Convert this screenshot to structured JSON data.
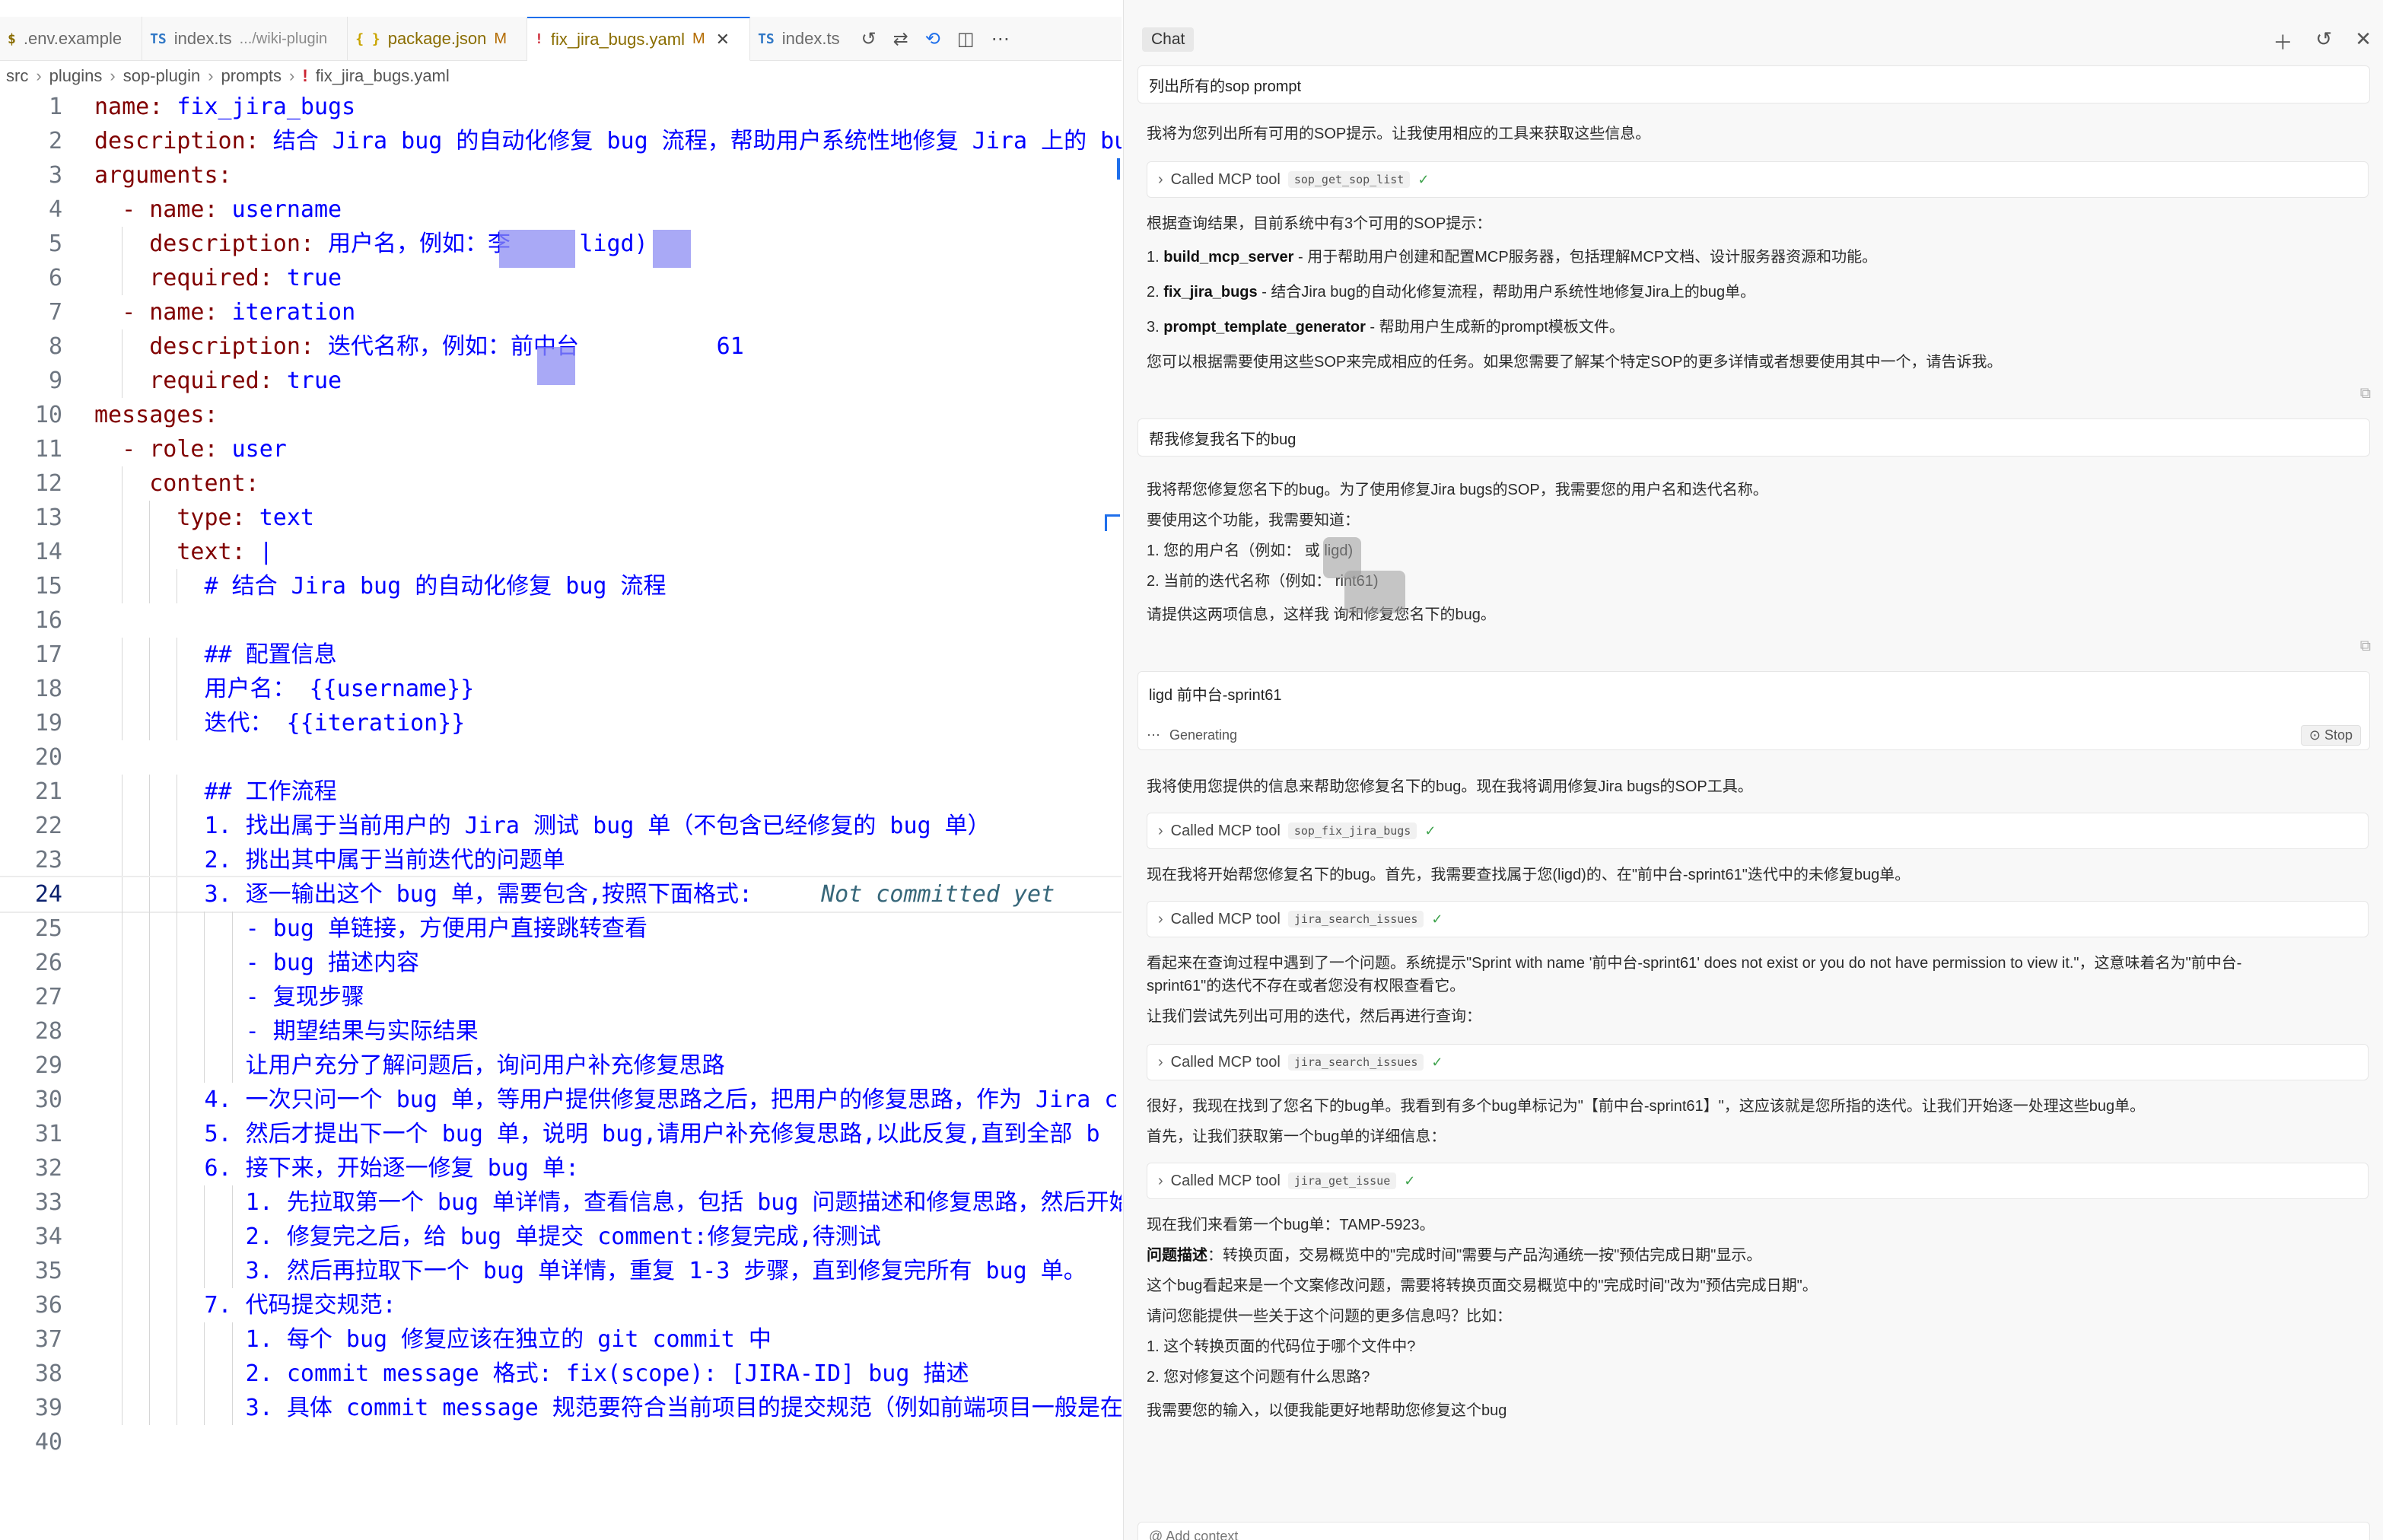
{
  "editor": {
    "tabs": [
      {
        "icon": "$",
        "name": ".env.example",
        "sub": "",
        "mod": "",
        "type": "env",
        "active": false
      },
      {
        "icon": "TS",
        "name": "index.ts",
        "sub": ".../wiki-plugin",
        "mod": "",
        "type": "ts",
        "active": false
      },
      {
        "icon": "{ }",
        "name": "package.json",
        "sub": "",
        "mod": "M",
        "type": "json",
        "active": false
      },
      {
        "icon": "!",
        "name": "fix_jira_bugs.yaml",
        "sub": "",
        "mod": "M",
        "type": "yaml",
        "active": true
      },
      {
        "icon": "TS",
        "name": "index.ts",
        "sub": "",
        "mod": "",
        "type": "ts",
        "active": false
      }
    ],
    "breadcrumb": [
      "src",
      "plugins",
      "sop-plugin",
      "prompts",
      "fix_jira_bugs.yaml"
    ],
    "ghost_text": "Not committed yet",
    "lines": [
      {
        "n": "1",
        "indent": 0,
        "key": "name:",
        "val": " fix_jira_bugs"
      },
      {
        "n": "2",
        "indent": 0,
        "key": "description:",
        "val": " 结合 Jira bug 的自动化修复 bug 流程，帮助用户系统性地修复 Jira 上的 bu"
      },
      {
        "n": "3",
        "indent": 0,
        "key": "arguments:",
        "val": ""
      },
      {
        "n": "4",
        "indent": 2,
        "key": "- name:",
        "val": " username"
      },
      {
        "n": "5",
        "indent": 4,
        "key": "description:",
        "val": " 用户名，例如：李     ligd)"
      },
      {
        "n": "6",
        "indent": 4,
        "key": "required:",
        "val": " true"
      },
      {
        "n": "7",
        "indent": 2,
        "key": "- name:",
        "val": " iteration"
      },
      {
        "n": "8",
        "indent": 4,
        "key": "description:",
        "val": " 迭代名称，例如：前中台          61"
      },
      {
        "n": "9",
        "indent": 4,
        "key": "required:",
        "val": " true"
      },
      {
        "n": "10",
        "indent": 0,
        "key": "messages:",
        "val": ""
      },
      {
        "n": "11",
        "indent": 2,
        "key": "- role:",
        "val": " user"
      },
      {
        "n": "12",
        "indent": 4,
        "key": "content:",
        "val": ""
      },
      {
        "n": "13",
        "indent": 6,
        "key": "type:",
        "val": " text"
      },
      {
        "n": "14",
        "indent": 6,
        "key": "text:",
        "val": " |"
      },
      {
        "n": "15",
        "indent": 8,
        "key": "",
        "val": "# 结合 Jira bug 的自动化修复 bug 流程"
      },
      {
        "n": "16",
        "indent": 0,
        "key": "",
        "val": ""
      },
      {
        "n": "17",
        "indent": 8,
        "key": "",
        "val": "## 配置信息"
      },
      {
        "n": "18",
        "indent": 8,
        "key": "",
        "val": "用户名： {{username}}"
      },
      {
        "n": "19",
        "indent": 8,
        "key": "",
        "val": "迭代： {{iteration}}"
      },
      {
        "n": "20",
        "indent": 0,
        "key": "",
        "val": ""
      },
      {
        "n": "21",
        "indent": 8,
        "key": "",
        "val": "## 工作流程"
      },
      {
        "n": "22",
        "indent": 8,
        "key": "",
        "val": "1. 找出属于当前用户的 Jira 测试 bug 单（不包含已经修复的 bug 单）"
      },
      {
        "n": "23",
        "indent": 8,
        "key": "",
        "val": "2. 挑出其中属于当前迭代的问题单"
      },
      {
        "n": "24",
        "indent": 8,
        "key": "",
        "val": "3. 逐一输出这个 bug 单，需要包含,按照下面格式:"
      },
      {
        "n": "25",
        "indent": 11,
        "key": "",
        "val": "- bug 单链接，方便用户直接跳转查看"
      },
      {
        "n": "26",
        "indent": 11,
        "key": "",
        "val": "- bug 描述内容"
      },
      {
        "n": "27",
        "indent": 11,
        "key": "",
        "val": "- 复现步骤"
      },
      {
        "n": "28",
        "indent": 11,
        "key": "",
        "val": "- 期望结果与实际结果"
      },
      {
        "n": "29",
        "indent": 11,
        "key": "",
        "val": "让用户充分了解问题后，询问用户补充修复思路"
      },
      {
        "n": "30",
        "indent": 8,
        "key": "",
        "val": "4. 一次只问一个 bug 单，等用户提供修复思路之后，把用户的修复思路，作为 Jira c"
      },
      {
        "n": "31",
        "indent": 8,
        "key": "",
        "val": "5. 然后才提出下一个 bug 单，说明 bug,请用户补充修复思路,以此反复,直到全部 b"
      },
      {
        "n": "32",
        "indent": 8,
        "key": "",
        "val": "6. 接下来，开始逐一修复 bug 单:"
      },
      {
        "n": "33",
        "indent": 11,
        "key": "",
        "val": "1. 先拉取第一个 bug 单详情，查看信息，包括 bug 问题描述和修复思路，然后开始"
      },
      {
        "n": "34",
        "indent": 11,
        "key": "",
        "val": "2. 修复完之后，给 bug 单提交 comment:修复完成,待测试"
      },
      {
        "n": "35",
        "indent": 11,
        "key": "",
        "val": "3. 然后再拉取下一个 bug 单详情，重复 1-3 步骤，直到修复完所有 bug 单。"
      },
      {
        "n": "36",
        "indent": 8,
        "key": "",
        "val": "7. 代码提交规范:"
      },
      {
        "n": "37",
        "indent": 11,
        "key": "",
        "val": "1. 每个 bug 修复应该在独立的 git commit 中"
      },
      {
        "n": "38",
        "indent": 11,
        "key": "",
        "val": "2. commit message 格式: fix(scope): [JIRA-ID] bug 描述"
      },
      {
        "n": "39",
        "indent": 11,
        "key": "",
        "val": "3. 具体 commit message 规范要符合当前项目的提交规范（例如前端项目一般是在"
      },
      {
        "n": "40",
        "indent": 0,
        "key": "",
        "val": ""
      }
    ]
  },
  "chat": {
    "title": "Chat",
    "user1": "列出所有的sop prompt",
    "a1_intro": "我将为您列出所有可用的SOP提示。让我使用相应的工具来获取这些信息。",
    "tool_label": "Called MCP tool",
    "tool1": "sop_get_sop_list",
    "a1_result": "根据查询结果，目前系统中有3个可用的SOP提示：",
    "a1_items": [
      {
        "num": "1. ",
        "name": "build_mcp_server",
        "desc": " - 用于帮助用户创建和配置MCP服务器，包括理解MCP文档、设计服务器资源和功能。"
      },
      {
        "num": "2. ",
        "name": "fix_jira_bugs",
        "desc": " - 结合Jira bug的自动化修复流程，帮助用户系统性地修复Jira上的bug单。"
      },
      {
        "num": "3. ",
        "name": "prompt_template_generator",
        "desc": " - 帮助用户生成新的prompt模板文件。"
      }
    ],
    "a1_outro": "您可以根据需要使用这些SOP来完成相应的任务。如果您需要了解某个特定SOP的更多详情或者想要使用其中一个，请告诉我。",
    "user2": "帮我修复我名下的bug",
    "a2_lines": [
      "我将帮您修复您名下的bug。为了使用修复Jira bugs的SOP，我需要您的用户名和迭代名称。",
      "要使用这个功能，我需要知道：",
      "1. 您的用户名（例如：        或 ligd)",
      "2. 当前的迭代名称（例如：        rint61)",
      "请提供这两项信息，这样我        询和修复您名下的bug。"
    ],
    "user3": "ligd  前中台-sprint61",
    "generating": "Generating",
    "stop": "Stop",
    "a3_line1": "我将使用您提供的信息来帮助您修复名下的bug。现在我将调用修复Jira bugs的SOP工具。",
    "tool2": "sop_fix_jira_bugs",
    "a3_line2": "现在我将开始帮您修复名下的bug。首先，我需要查找属于您(ligd)的、在\"前中台-sprint61\"迭代中的未修复bug单。",
    "tool3": "jira_search_issues",
    "a3_line3a": "看起来在查询过程中遇到了一个问题。系统提示\"Sprint with name '前中台-sprint61' does not exist or you do not have permission to view it.\"，这意味着名为\"前中台-",
    "a3_line3b": "sprint61\"的迭代不存在或者您没有权限查看它。",
    "a3_line4": "让我们尝试先列出可用的迭代，然后再进行查询：",
    "tool4": "jira_search_issues",
    "a3_line5": "很好，我现在找到了您名下的bug单。我看到有多个bug单标记为\"【前中台-sprint61】\"，这应该就是您所指的迭代。让我们开始逐一处理这些bug单。",
    "a3_line6": "首先，让我们获取第一个bug单的详细信息：",
    "tool5": "jira_get_issue",
    "a3_line7": "现在我们来看第一个bug单：TAMP-5923。",
    "a3_label": "问题描述",
    "a3_line8": "：转换页面，交易概览中的\"完成时间\"需要与产品沟通统一按\"预估完成日期\"显示。",
    "a3_line9": "这个bug看起来是一个文案修改问题，需要将转换页面交易概览中的\"完成时间\"改为\"预估完成日期\"。",
    "a3_line10": "请问您能提供一些关于这个问题的更多信息吗？比如：",
    "a3_line11": "1. 这个转换页面的代码位于哪个文件中?",
    "a3_line12": "2. 您对修复这个问题有什么思路?",
    "a3_line13": "我需要您的输入，以便我能更好地帮助您修复这个bug",
    "add_context": "Add context"
  }
}
